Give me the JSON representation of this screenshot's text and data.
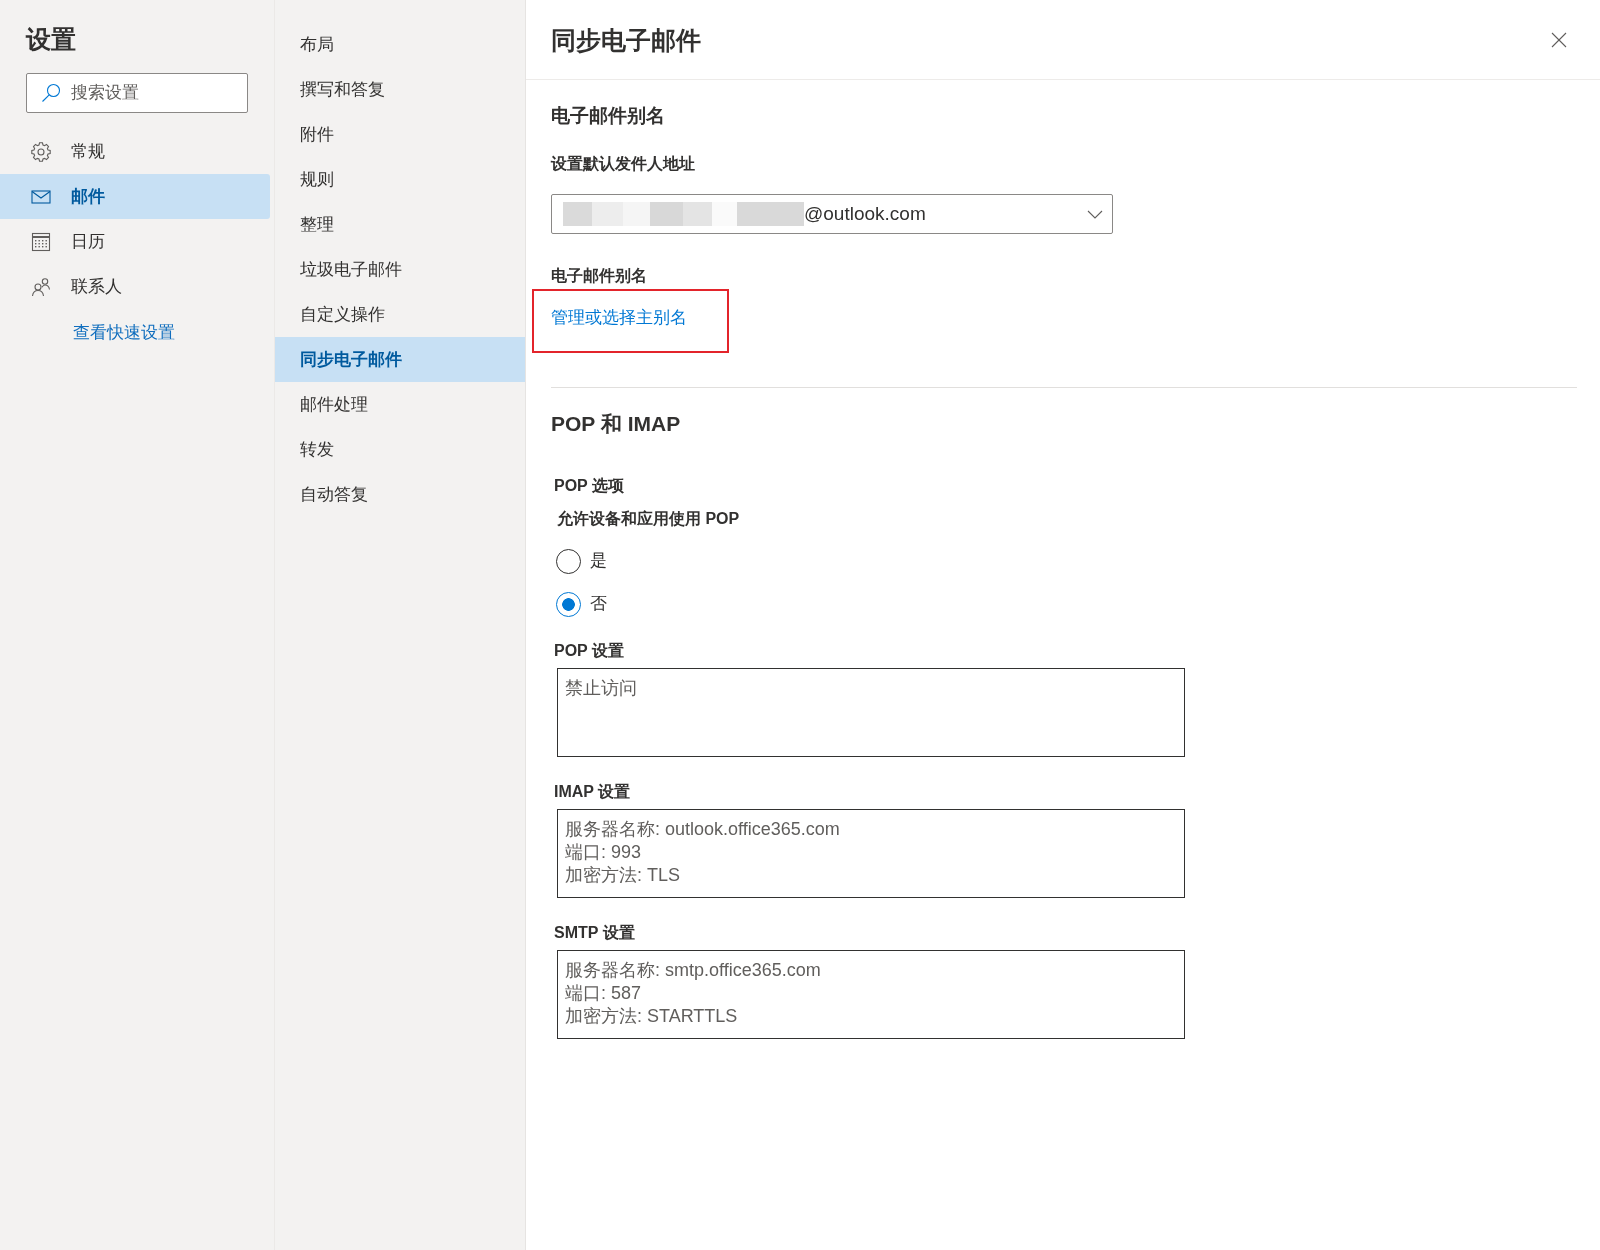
{
  "sidebar": {
    "title": "设置",
    "search": {
      "placeholder": "搜索设置"
    },
    "items": [
      {
        "label": "常规",
        "selected": false
      },
      {
        "label": "邮件",
        "selected": true
      },
      {
        "label": "日历",
        "selected": false
      },
      {
        "label": "联系人",
        "selected": false
      }
    ],
    "quick_settings_link": "查看快速设置"
  },
  "subnav": {
    "items": [
      {
        "label": "布局",
        "selected": false
      },
      {
        "label": "撰写和答复",
        "selected": false
      },
      {
        "label": "附件",
        "selected": false
      },
      {
        "label": "规则",
        "selected": false
      },
      {
        "label": "整理",
        "selected": false
      },
      {
        "label": "垃圾电子邮件",
        "selected": false
      },
      {
        "label": "自定义操作",
        "selected": false
      },
      {
        "label": "同步电子邮件",
        "selected": true
      },
      {
        "label": "邮件处理",
        "selected": false
      },
      {
        "label": "转发",
        "selected": false
      },
      {
        "label": "自动答复",
        "selected": false
      }
    ]
  },
  "panel": {
    "title": "同步电子邮件",
    "alias": {
      "heading": "电子邮件别名",
      "default_sender_label": "设置默认发件人地址",
      "default_sender": {
        "value": "@outlook.com",
        "redacted": true
      },
      "label": "电子邮件别名",
      "link": {
        "label": "管理或选择主别名",
        "highlighted": true
      }
    },
    "pop_imap": {
      "heading": "POP 和 IMAP",
      "pop_options_label": "POP 选项",
      "allow_pop_label": "允许设备和应用使用 POP",
      "options": [
        {
          "label": "是",
          "selected": false
        },
        {
          "label": "否",
          "selected": true
        }
      ],
      "settings": [
        {
          "label": "POP 设置",
          "value": "禁止访问"
        },
        {
          "label": "IMAP 设置",
          "value": "服务器名称: outlook.office365.com\n端口: 993\n加密方法: TLS"
        },
        {
          "label": "SMTP 设置",
          "value": "服务器名称: smtp.office365.com\n端口: 587\n加密方法: STARTTLS"
        }
      ]
    }
  }
}
